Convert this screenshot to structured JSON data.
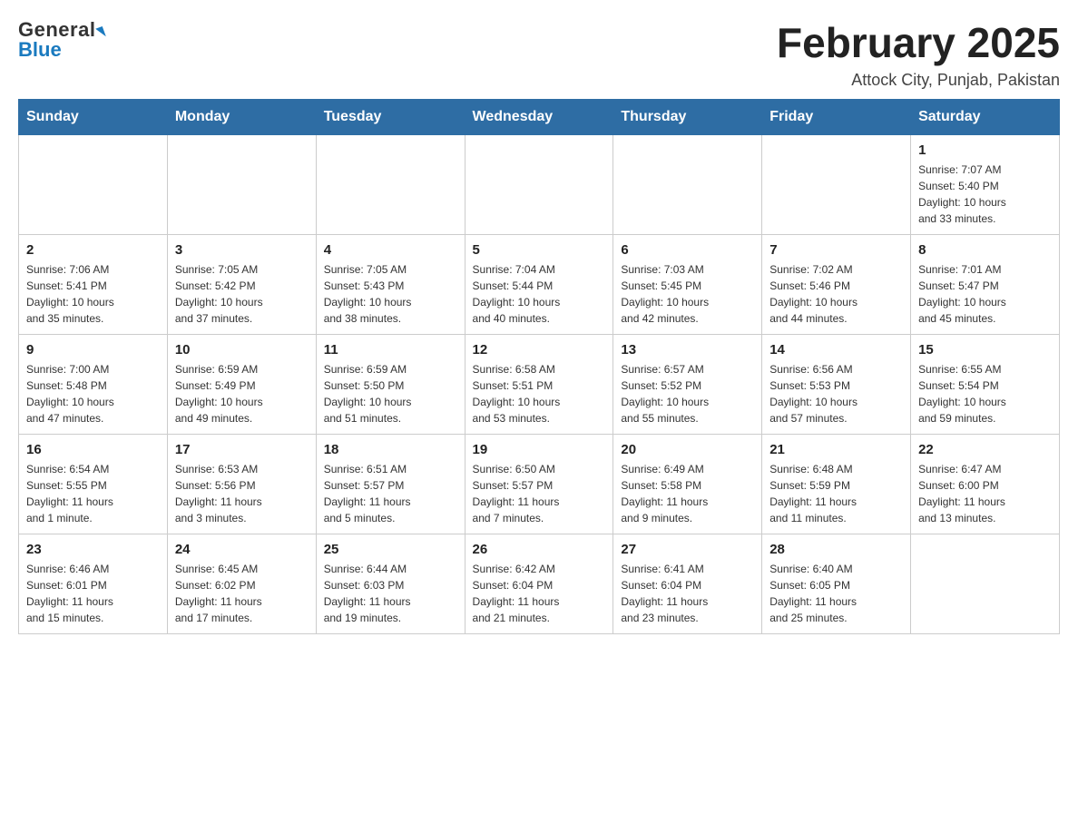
{
  "header": {
    "logo_general": "General",
    "logo_blue": "Blue",
    "month_title": "February 2025",
    "location": "Attock City, Punjab, Pakistan"
  },
  "weekdays": [
    "Sunday",
    "Monday",
    "Tuesday",
    "Wednesday",
    "Thursday",
    "Friday",
    "Saturday"
  ],
  "weeks": [
    [
      {
        "day": "",
        "info": ""
      },
      {
        "day": "",
        "info": ""
      },
      {
        "day": "",
        "info": ""
      },
      {
        "day": "",
        "info": ""
      },
      {
        "day": "",
        "info": ""
      },
      {
        "day": "",
        "info": ""
      },
      {
        "day": "1",
        "info": "Sunrise: 7:07 AM\nSunset: 5:40 PM\nDaylight: 10 hours\nand 33 minutes."
      }
    ],
    [
      {
        "day": "2",
        "info": "Sunrise: 7:06 AM\nSunset: 5:41 PM\nDaylight: 10 hours\nand 35 minutes."
      },
      {
        "day": "3",
        "info": "Sunrise: 7:05 AM\nSunset: 5:42 PM\nDaylight: 10 hours\nand 37 minutes."
      },
      {
        "day": "4",
        "info": "Sunrise: 7:05 AM\nSunset: 5:43 PM\nDaylight: 10 hours\nand 38 minutes."
      },
      {
        "day": "5",
        "info": "Sunrise: 7:04 AM\nSunset: 5:44 PM\nDaylight: 10 hours\nand 40 minutes."
      },
      {
        "day": "6",
        "info": "Sunrise: 7:03 AM\nSunset: 5:45 PM\nDaylight: 10 hours\nand 42 minutes."
      },
      {
        "day": "7",
        "info": "Sunrise: 7:02 AM\nSunset: 5:46 PM\nDaylight: 10 hours\nand 44 minutes."
      },
      {
        "day": "8",
        "info": "Sunrise: 7:01 AM\nSunset: 5:47 PM\nDaylight: 10 hours\nand 45 minutes."
      }
    ],
    [
      {
        "day": "9",
        "info": "Sunrise: 7:00 AM\nSunset: 5:48 PM\nDaylight: 10 hours\nand 47 minutes."
      },
      {
        "day": "10",
        "info": "Sunrise: 6:59 AM\nSunset: 5:49 PM\nDaylight: 10 hours\nand 49 minutes."
      },
      {
        "day": "11",
        "info": "Sunrise: 6:59 AM\nSunset: 5:50 PM\nDaylight: 10 hours\nand 51 minutes."
      },
      {
        "day": "12",
        "info": "Sunrise: 6:58 AM\nSunset: 5:51 PM\nDaylight: 10 hours\nand 53 minutes."
      },
      {
        "day": "13",
        "info": "Sunrise: 6:57 AM\nSunset: 5:52 PM\nDaylight: 10 hours\nand 55 minutes."
      },
      {
        "day": "14",
        "info": "Sunrise: 6:56 AM\nSunset: 5:53 PM\nDaylight: 10 hours\nand 57 minutes."
      },
      {
        "day": "15",
        "info": "Sunrise: 6:55 AM\nSunset: 5:54 PM\nDaylight: 10 hours\nand 59 minutes."
      }
    ],
    [
      {
        "day": "16",
        "info": "Sunrise: 6:54 AM\nSunset: 5:55 PM\nDaylight: 11 hours\nand 1 minute."
      },
      {
        "day": "17",
        "info": "Sunrise: 6:53 AM\nSunset: 5:56 PM\nDaylight: 11 hours\nand 3 minutes."
      },
      {
        "day": "18",
        "info": "Sunrise: 6:51 AM\nSunset: 5:57 PM\nDaylight: 11 hours\nand 5 minutes."
      },
      {
        "day": "19",
        "info": "Sunrise: 6:50 AM\nSunset: 5:57 PM\nDaylight: 11 hours\nand 7 minutes."
      },
      {
        "day": "20",
        "info": "Sunrise: 6:49 AM\nSunset: 5:58 PM\nDaylight: 11 hours\nand 9 minutes."
      },
      {
        "day": "21",
        "info": "Sunrise: 6:48 AM\nSunset: 5:59 PM\nDaylight: 11 hours\nand 11 minutes."
      },
      {
        "day": "22",
        "info": "Sunrise: 6:47 AM\nSunset: 6:00 PM\nDaylight: 11 hours\nand 13 minutes."
      }
    ],
    [
      {
        "day": "23",
        "info": "Sunrise: 6:46 AM\nSunset: 6:01 PM\nDaylight: 11 hours\nand 15 minutes."
      },
      {
        "day": "24",
        "info": "Sunrise: 6:45 AM\nSunset: 6:02 PM\nDaylight: 11 hours\nand 17 minutes."
      },
      {
        "day": "25",
        "info": "Sunrise: 6:44 AM\nSunset: 6:03 PM\nDaylight: 11 hours\nand 19 minutes."
      },
      {
        "day": "26",
        "info": "Sunrise: 6:42 AM\nSunset: 6:04 PM\nDaylight: 11 hours\nand 21 minutes."
      },
      {
        "day": "27",
        "info": "Sunrise: 6:41 AM\nSunset: 6:04 PM\nDaylight: 11 hours\nand 23 minutes."
      },
      {
        "day": "28",
        "info": "Sunrise: 6:40 AM\nSunset: 6:05 PM\nDaylight: 11 hours\nand 25 minutes."
      },
      {
        "day": "",
        "info": ""
      }
    ]
  ]
}
